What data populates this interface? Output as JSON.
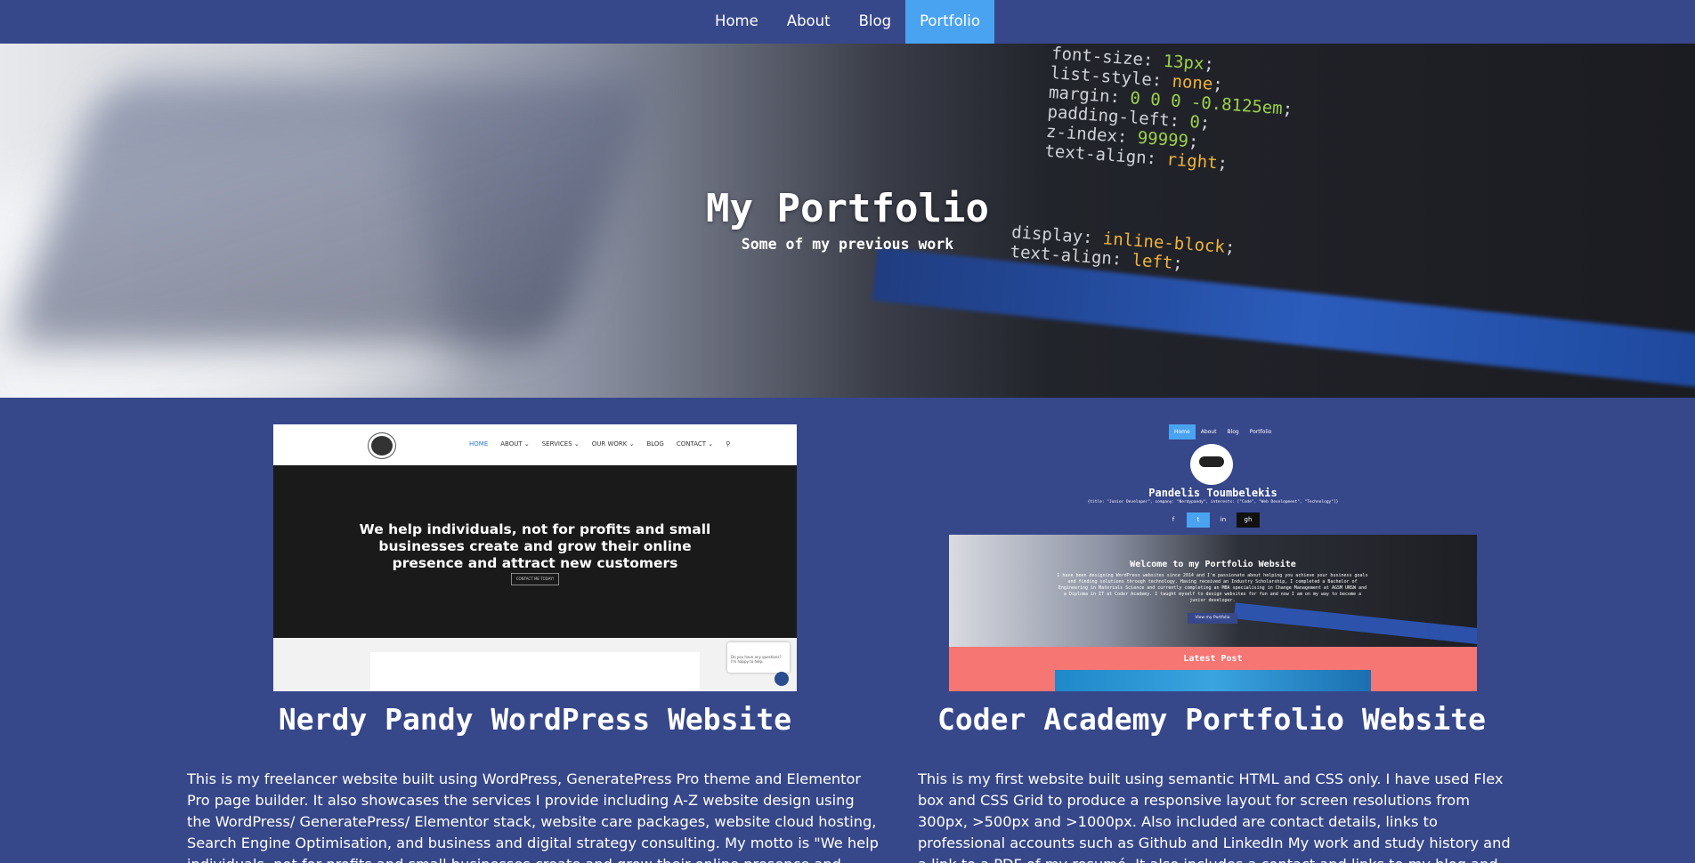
{
  "nav": {
    "items": [
      "Home",
      "About",
      "Blog",
      "Portfolio"
    ],
    "active": "Portfolio"
  },
  "hero": {
    "title": "My Portfolio",
    "subtitle": "Some of my previous work",
    "code_lines": [
      {
        "prop": "font-size",
        "val": "13px"
      },
      {
        "prop": "list-style",
        "val": "none"
      },
      {
        "prop": "margin",
        "val": "0 0 0 -0.8125em"
      },
      {
        "prop": "padding-left",
        "val": "0"
      },
      {
        "prop": "z-index",
        "val": "99999"
      },
      {
        "prop": "text-align",
        "val": "right"
      }
    ],
    "code_lines_2": [
      {
        "prop": "display",
        "val": "inline-block"
      },
      {
        "prop": "text-align",
        "val": "left"
      }
    ]
  },
  "projects": [
    {
      "title": "Nerdy Pandy WordPress Website",
      "description": "This is my freelancer website built using WordPress, GeneratePress Pro theme and Elementor Pro page builder. It also showcases the services I provide including A-Z website design using the WordPress/ GeneratePress/ Elementor stack, website care packages, website cloud hosting, Search Engine Optimisation, and business and digital strategy consulting. My motto is \"We help individuals, not for profits and small businesses create and grow their online presence and attract new customers\".",
      "thumb": {
        "menu": [
          "HOME",
          "ABOUT ⌄",
          "SERVICES ⌄",
          "OUR WORK ⌄",
          "BLOG",
          "CONTACT ⌄",
          "⚲"
        ],
        "headline": "We help individuals, not for profits and small businesses create and grow their online presence and attract new customers",
        "button": "CONTACT ME TODAY!",
        "chat": "Do you have any questions? I'm happy to help."
      }
    },
    {
      "title": "Coder Academy Portfolio Website",
      "description": "This is my first website built using semantic HTML and CSS only. I have used Flex box and CSS Grid to produce a responsive layout for screen resolutions from 300px, >500px and >1000px. Also included are contact details, links to professional accounts such as Github and LinkedIn My work and study history and a link to a PDF of my resumé. It also includes a contact and links to my blog and social media and portfolio of my work and interests.",
      "thumb": {
        "nav": [
          "Home",
          "About",
          "Blog",
          "Portfolio"
        ],
        "name": "Pandelis Toumbelekis",
        "object": "{title: \"Junior Developer\", company: \"Nerdypandy\", interests: [\"Code\", \"Web Development\", \"Technology\"]}",
        "socials": [
          "f",
          "t",
          "in",
          "gh"
        ],
        "welcome": "Welcome to my Portfolio Website",
        "intro": "I have been designing WordPress websites since 2014 and I'm passionate about helping you achieve your business goals and finding solutions through technology. Having received an Industry Scholarship, I completed a Bachelor of Engineering in Materials Science and currently completing an MBA specialising in Change Management at AGSM UNSW and a Diploma in IT at Coder Academy. I taught myself to design websites for fun and now I am on my way to become a junior developer.",
        "button": "View my Portfolio",
        "latest": "Latest Post"
      }
    }
  ],
  "colors": {
    "background": "#36478a",
    "nav_active": "#4aa3f0",
    "latest_post": "#f67673"
  }
}
